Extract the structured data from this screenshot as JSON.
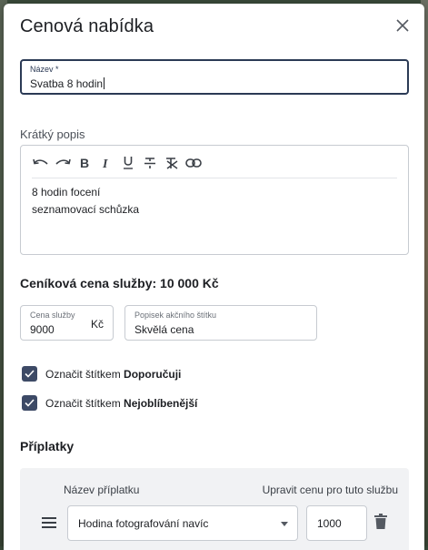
{
  "dialog": {
    "title": "Cenová nabídka",
    "close_icon": "close-icon"
  },
  "name_field": {
    "label": "Název *",
    "value": "Svatba 8 hodin"
  },
  "short_description": {
    "label": "Krátký popis",
    "toolbar": [
      "undo-icon",
      "redo-icon",
      "bold-icon",
      "italic-icon",
      "underline-icon",
      "strikethrough-icon",
      "clear-format-icon",
      "link-icon"
    ],
    "lines": [
      "8 hodin focení",
      "seznamovací schůzka"
    ]
  },
  "price_list": {
    "heading": "Ceníková cena služby: 10 000 Kč"
  },
  "service_price": {
    "label": "Cena služby",
    "value": "9000",
    "suffix": "Kč"
  },
  "promo_label": {
    "label": "Popisek akčního štítku",
    "value": "Skvělá cena"
  },
  "checkboxes": [
    {
      "prefix": "Označit štítkem",
      "bold": "Doporučuji",
      "checked": true
    },
    {
      "prefix": "Označit štítkem",
      "bold": "Nejoblíbenější",
      "checked": true
    }
  ],
  "surcharges": {
    "heading": "Příplatky",
    "col_name": "Název příplatku",
    "col_price": "Upravit cenu pro tuto službu",
    "rows": [
      {
        "name": "Hodina fotografování navíc",
        "price": "1000"
      }
    ]
  },
  "colors": {
    "accent": "#3d4a66",
    "focus_border": "#2b3a55"
  }
}
